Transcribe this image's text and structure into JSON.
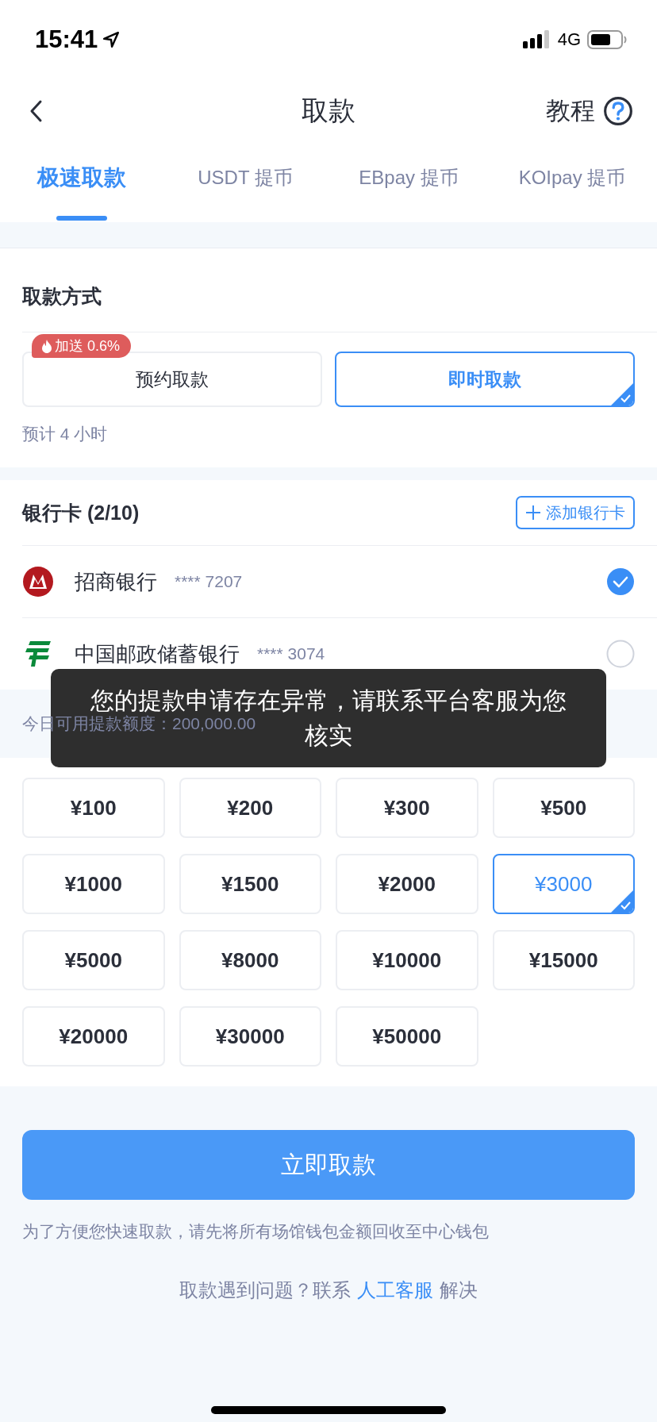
{
  "status_bar": {
    "time": "15:41",
    "network": "4G"
  },
  "nav": {
    "title": "取款",
    "help_label": "教程"
  },
  "tabs": [
    {
      "label": "极速取款",
      "selected": true
    },
    {
      "label": "USDT 提币",
      "selected": false
    },
    {
      "label": "EBpay 提币",
      "selected": false
    },
    {
      "label": "KOIpay 提币",
      "selected": false
    }
  ],
  "method": {
    "heading": "取款方式",
    "options": [
      {
        "label": "预约取款",
        "selected": false,
        "badge": "加送 0.6%"
      },
      {
        "label": "即时取款",
        "selected": true
      }
    ],
    "note": "预计 4 小时"
  },
  "bank_cards": {
    "heading": "银行卡 (2/10)",
    "add_button": "添加银行卡",
    "cards": [
      {
        "kind": "cmb",
        "name": "招商银行",
        "number": "**** 7207",
        "selected": true
      },
      {
        "kind": "postal",
        "name": "中国邮政储蓄银行",
        "number": "**** 3074",
        "selected": false
      }
    ]
  },
  "daily_limit": "今日可用提款额度：200,000.00",
  "amounts": [
    {
      "label": "¥100",
      "selected": false
    },
    {
      "label": "¥200",
      "selected": false
    },
    {
      "label": "¥300",
      "selected": false
    },
    {
      "label": "¥500",
      "selected": false
    },
    {
      "label": "¥1000",
      "selected": false
    },
    {
      "label": "¥1500",
      "selected": false
    },
    {
      "label": "¥2000",
      "selected": false
    },
    {
      "label": "¥3000",
      "selected": true
    },
    {
      "label": "¥5000",
      "selected": false
    },
    {
      "label": "¥8000",
      "selected": false
    },
    {
      "label": "¥10000",
      "selected": false
    },
    {
      "label": "¥15000",
      "selected": false
    },
    {
      "label": "¥20000",
      "selected": false
    },
    {
      "label": "¥30000",
      "selected": false
    },
    {
      "label": "¥50000",
      "selected": false
    }
  ],
  "submit_button": "立即取款",
  "hint": "为了方便您快速取款，请先将所有场馆钱包金额回收至中心钱包",
  "help": {
    "before": "取款遇到问题？联系",
    "link": "人工客服",
    "after": "解决"
  },
  "toast": "您的提款申请存在异常，请联系平台客服为您核实"
}
